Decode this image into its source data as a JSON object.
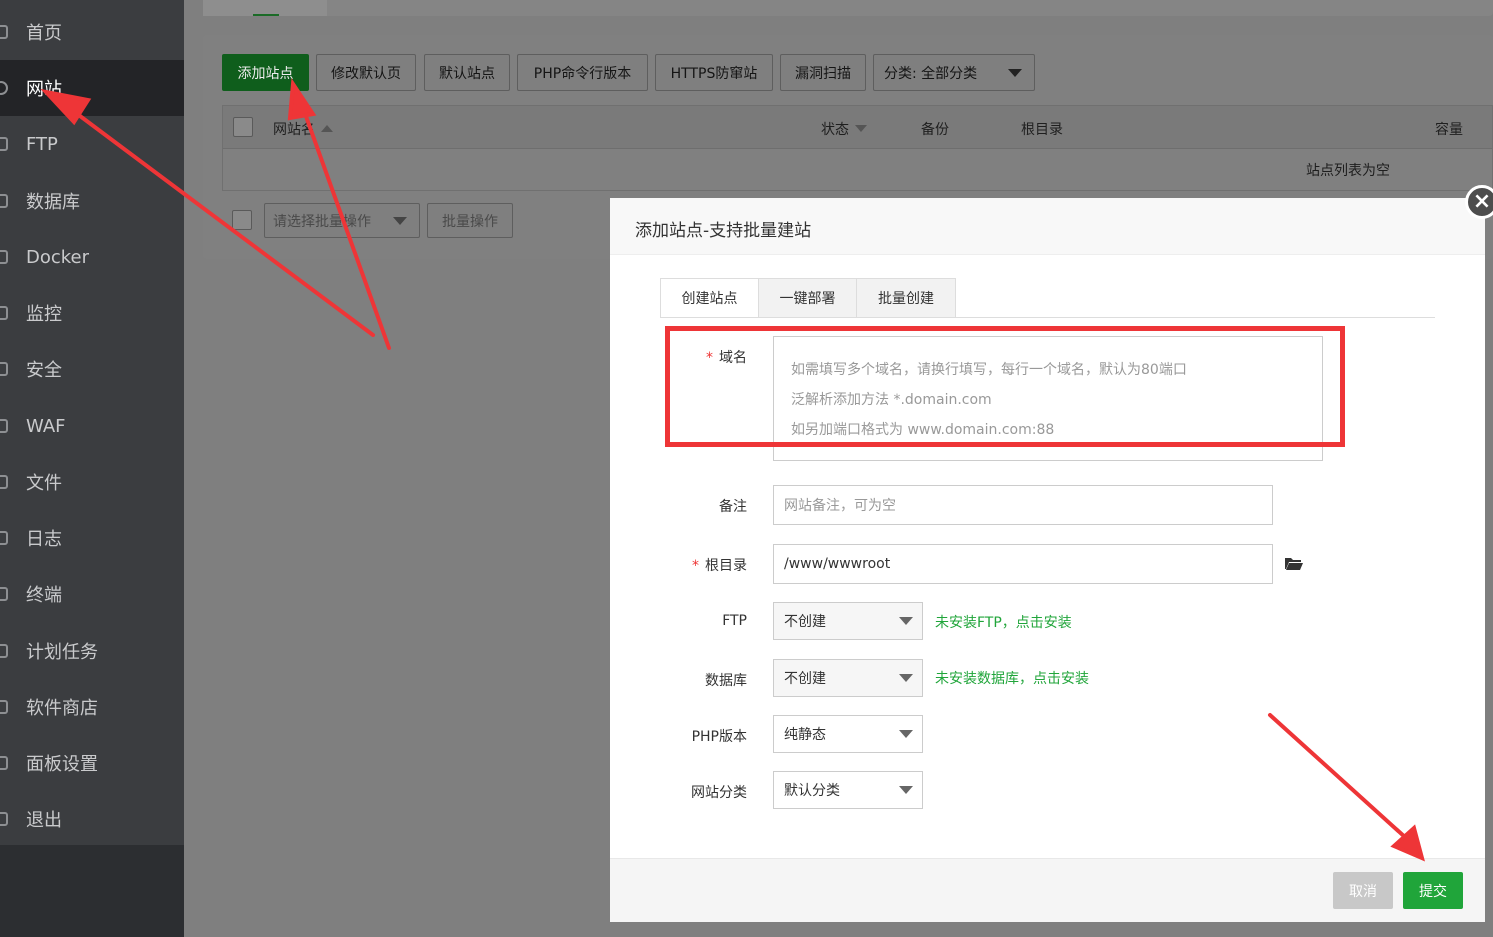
{
  "sidebar": {
    "items": [
      {
        "label": "首页",
        "icon": "home-icon"
      },
      {
        "label": "网站",
        "icon": "globe-icon",
        "active": true
      },
      {
        "label": "FTP",
        "icon": "ftp-icon"
      },
      {
        "label": "数据库",
        "icon": "database-icon"
      },
      {
        "label": "Docker",
        "icon": "docker-icon"
      },
      {
        "label": "监控",
        "icon": "monitor-icon"
      },
      {
        "label": "安全",
        "icon": "shield-icon"
      },
      {
        "label": "WAF",
        "icon": "waf-icon"
      },
      {
        "label": "文件",
        "icon": "folder-icon"
      },
      {
        "label": "日志",
        "icon": "log-icon"
      },
      {
        "label": "终端",
        "icon": "terminal-icon"
      },
      {
        "label": "计划任务",
        "icon": "calendar-icon"
      },
      {
        "label": "软件商店",
        "icon": "store-icon"
      },
      {
        "label": "面板设置",
        "icon": "settings-icon"
      },
      {
        "label": "退出",
        "icon": "logout-icon"
      }
    ]
  },
  "toolbar": {
    "add_site": "添加站点",
    "edit_default_page": "修改默认页",
    "default_site": "默认站点",
    "php_cli_version": "PHP命令行版本",
    "https_anti_tamper": "HTTPS防窜站",
    "vuln_scan": "漏洞扫描",
    "category_filter": "分类: 全部分类"
  },
  "table": {
    "columns": {
      "name": "网站名",
      "status": "状态",
      "backup": "备份",
      "root": "根目录",
      "capacity": "容量"
    },
    "empty_text": "站点列表为空",
    "batch_select_placeholder": "请选择批量操作",
    "batch_button": "批量操作"
  },
  "modal": {
    "title": "添加站点-支持批量建站",
    "tabs": [
      "创建站点",
      "一键部署",
      "批量创建"
    ],
    "fields": {
      "domain_label": "域名",
      "domain_placeholder_lines": [
        "如需填写多个域名，请换行填写，每行一个域名，默认为80端口",
        "泛解析添加方法 *.domain.com",
        "如另加端口格式为 www.domain.com:88"
      ],
      "remark_label": "备注",
      "remark_placeholder": "网站备注，可为空",
      "root_label": "根目录",
      "root_value": "/www/wwwroot",
      "ftp_label": "FTP",
      "ftp_value": "不创建",
      "ftp_hint": "未安装FTP，点击安装",
      "db_label": "数据库",
      "db_value": "不创建",
      "db_hint": "未安装数据库，点击安装",
      "php_label": "PHP版本",
      "php_value": "纯静态",
      "category_label": "网站分类",
      "category_value": "默认分类"
    },
    "cancel": "取消",
    "submit": "提交",
    "close_glyph": "×"
  },
  "colors": {
    "accent_green": "#20a53a",
    "annotation_red": "#ee3537"
  }
}
